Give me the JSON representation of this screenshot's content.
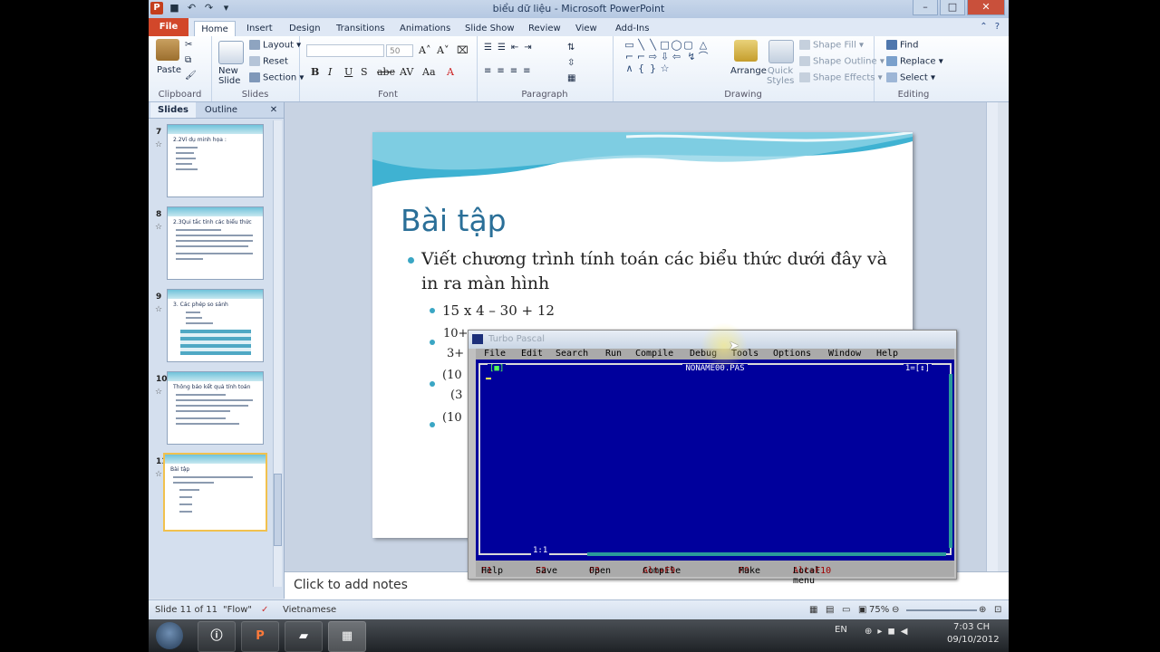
{
  "window": {
    "title": "biểu dữ liệu - Microsoft PowerPoint"
  },
  "ribbon": {
    "tabs": [
      "File",
      "Home",
      "Insert",
      "Design",
      "Transitions",
      "Animations",
      "Slide Show",
      "Review",
      "View",
      "Add-Ins"
    ],
    "clipboard": {
      "paste": "Paste",
      "label": "Clipboard"
    },
    "slides": {
      "new_slide": "New Slide",
      "layout": "Layout",
      "reset": "Reset",
      "section": "Section",
      "label": "Slides"
    },
    "font": {
      "size": "50",
      "label": "Font"
    },
    "paragraph": {
      "label": "Paragraph"
    },
    "drawing": {
      "arrange": "Arrange",
      "quick_styles": "Quick Styles",
      "shape_fill": "Shape Fill",
      "shape_outline": "Shape Outline",
      "shape_effects": "Shape Effects",
      "label": "Drawing"
    },
    "editing": {
      "find": "Find",
      "replace": "Replace",
      "select": "Select",
      "label": "Editing"
    }
  },
  "slides_panel": {
    "tabs": {
      "slides": "Slides",
      "outline": "Outline",
      "close": "✕"
    },
    "thumbnails": [
      {
        "num": "7",
        "title": "2.2Ví dụ minh họa :"
      },
      {
        "num": "8",
        "title": "2.3Qui tắc tính các biểu thức"
      },
      {
        "num": "9",
        "title": "3. Các phép so sánh"
      },
      {
        "num": "10",
        "title": "Thông báo kết quả tính toán"
      },
      {
        "num": "11",
        "title": "Bài tập"
      }
    ]
  },
  "slide": {
    "title": "Bài tập",
    "bullet1_line1": "Viết chương trình tính toán các biểu thức dưới đây và",
    "bullet1_line2": "in ra màn hình",
    "sub1": "15 x 4 – 30 + 12",
    "sub2_top": "10+",
    "sub2_bottom": "3+",
    "sub3_top": "(10",
    "sub3_bottom": "(3",
    "sub4_top": "(10"
  },
  "notes": {
    "placeholder": "Click to add notes"
  },
  "status_bar": {
    "slide_info": "Slide 11 of 11",
    "theme": "\"Flow\"",
    "language": "Vietnamese",
    "zoom": "75%"
  },
  "turbo_pascal": {
    "title": "Turbo Pascal",
    "menu": [
      "File",
      "Edit",
      "Search",
      "Run",
      "Compile",
      "Debug",
      "Tools",
      "Options",
      "Window",
      "Help"
    ],
    "filename": "NONAME00.PAS",
    "window_number": "1=[↕]",
    "close_box": "[■]",
    "cursor_pos": "1:1",
    "status": [
      {
        "key": "F1",
        "label": "Help"
      },
      {
        "key": "F2",
        "label": "Save"
      },
      {
        "key": "F3",
        "label": "Open"
      },
      {
        "key": "Alt+F9",
        "label": "Compile"
      },
      {
        "key": "F9",
        "label": "Make"
      },
      {
        "key": "Alt+F10",
        "label": "Local menu"
      }
    ]
  },
  "taskbar": {
    "lang": "EN",
    "time": "7:03 CH",
    "date": "09/10/2012"
  },
  "colors": {
    "accent": "#2a6f98",
    "file_tab": "#d2472a",
    "tp_editor": "#00009c",
    "tp_menu": "#aaaaaa"
  }
}
